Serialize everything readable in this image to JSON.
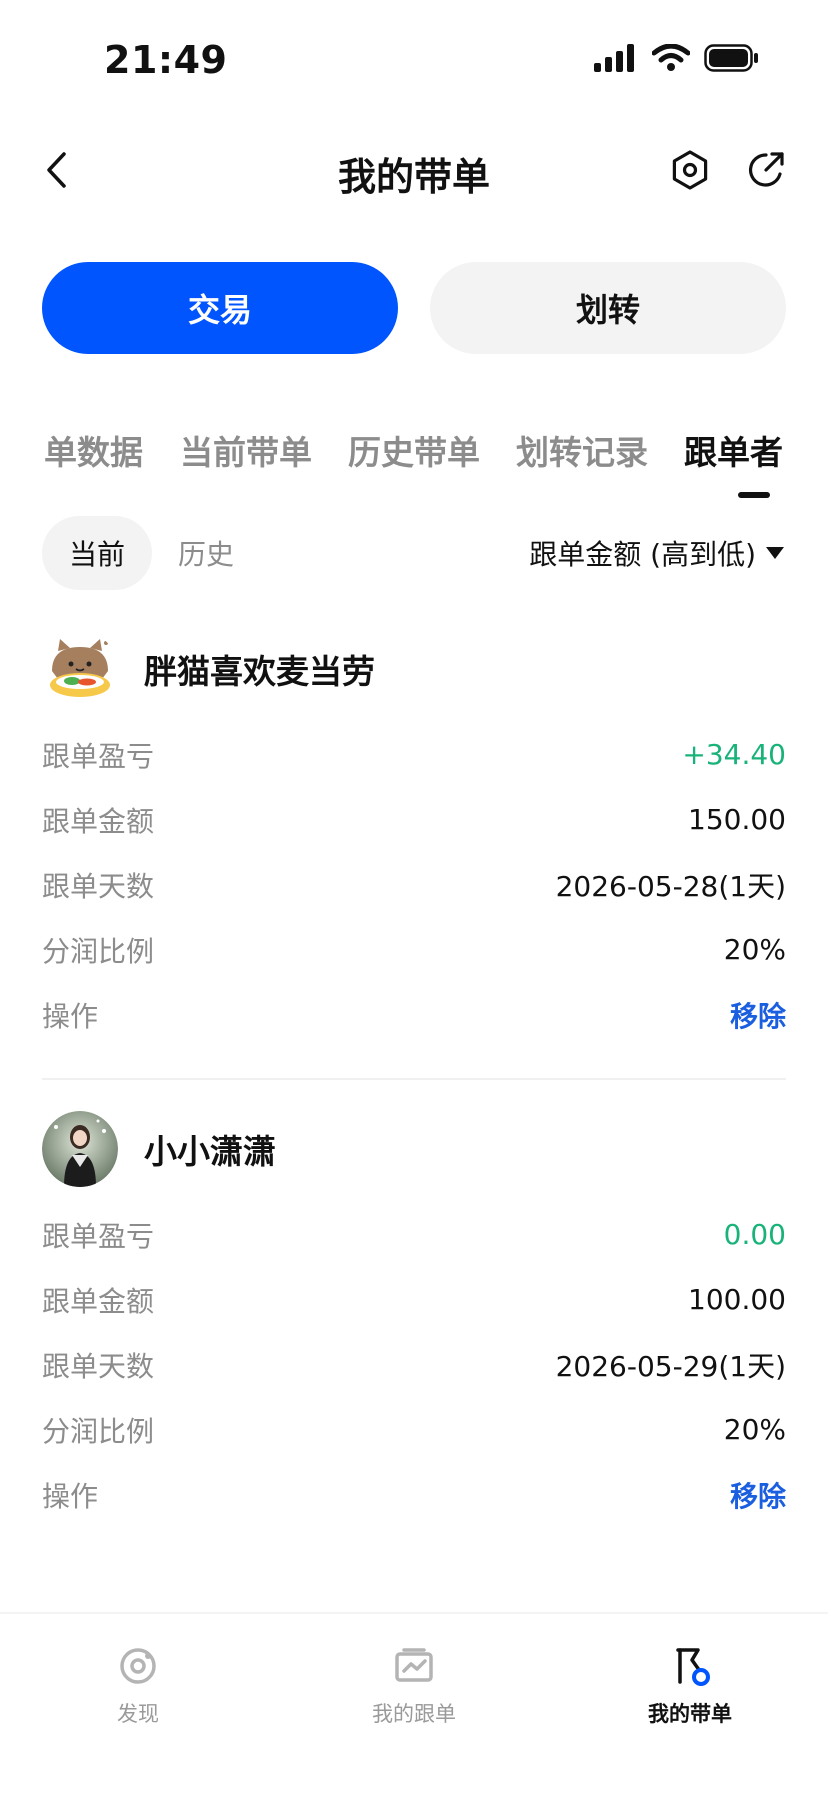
{
  "status_bar": {
    "time": "21:49"
  },
  "nav": {
    "title": "我的带单"
  },
  "actions": {
    "trade_label": "交易",
    "transfer_label": "划转"
  },
  "tabs": [
    {
      "label": "单数据"
    },
    {
      "label": "当前带单"
    },
    {
      "label": "历史带单"
    },
    {
      "label": "划转记录"
    },
    {
      "label": "跟单者",
      "active": true
    }
  ],
  "subtabs": {
    "current": "当前",
    "history": "历史"
  },
  "sort": {
    "label": "跟单金额 (高到低)"
  },
  "followers": [
    {
      "name": "胖猫喜欢麦当劳",
      "rows": [
        {
          "label": "跟单盈亏",
          "value": "+34.40"
        },
        {
          "label": "跟单金额",
          "value": "150.00"
        },
        {
          "label": "跟单天数",
          "value": "2026-05-28(1天)"
        },
        {
          "label": "分润比例",
          "value": "20%"
        },
        {
          "label": "操作",
          "value": "移除"
        }
      ]
    },
    {
      "name": "小小潇潇",
      "rows": [
        {
          "label": "跟单盈亏",
          "value": "0.00"
        },
        {
          "label": "跟单金额",
          "value": "100.00"
        },
        {
          "label": "跟单天数",
          "value": "2026-05-29(1天)"
        },
        {
          "label": "分润比例",
          "value": "20%"
        },
        {
          "label": "操作",
          "value": "移除"
        }
      ]
    }
  ],
  "bottom_nav": [
    {
      "label": "发现",
      "icon": "discover-icon"
    },
    {
      "label": "我的跟单",
      "icon": "chart-icon"
    },
    {
      "label": "我的带单",
      "icon": "flag-icon",
      "active": true
    }
  ],
  "colors": {
    "accent": "#0055ff",
    "profit": "#19b37a",
    "link": "#1a5fe0"
  }
}
